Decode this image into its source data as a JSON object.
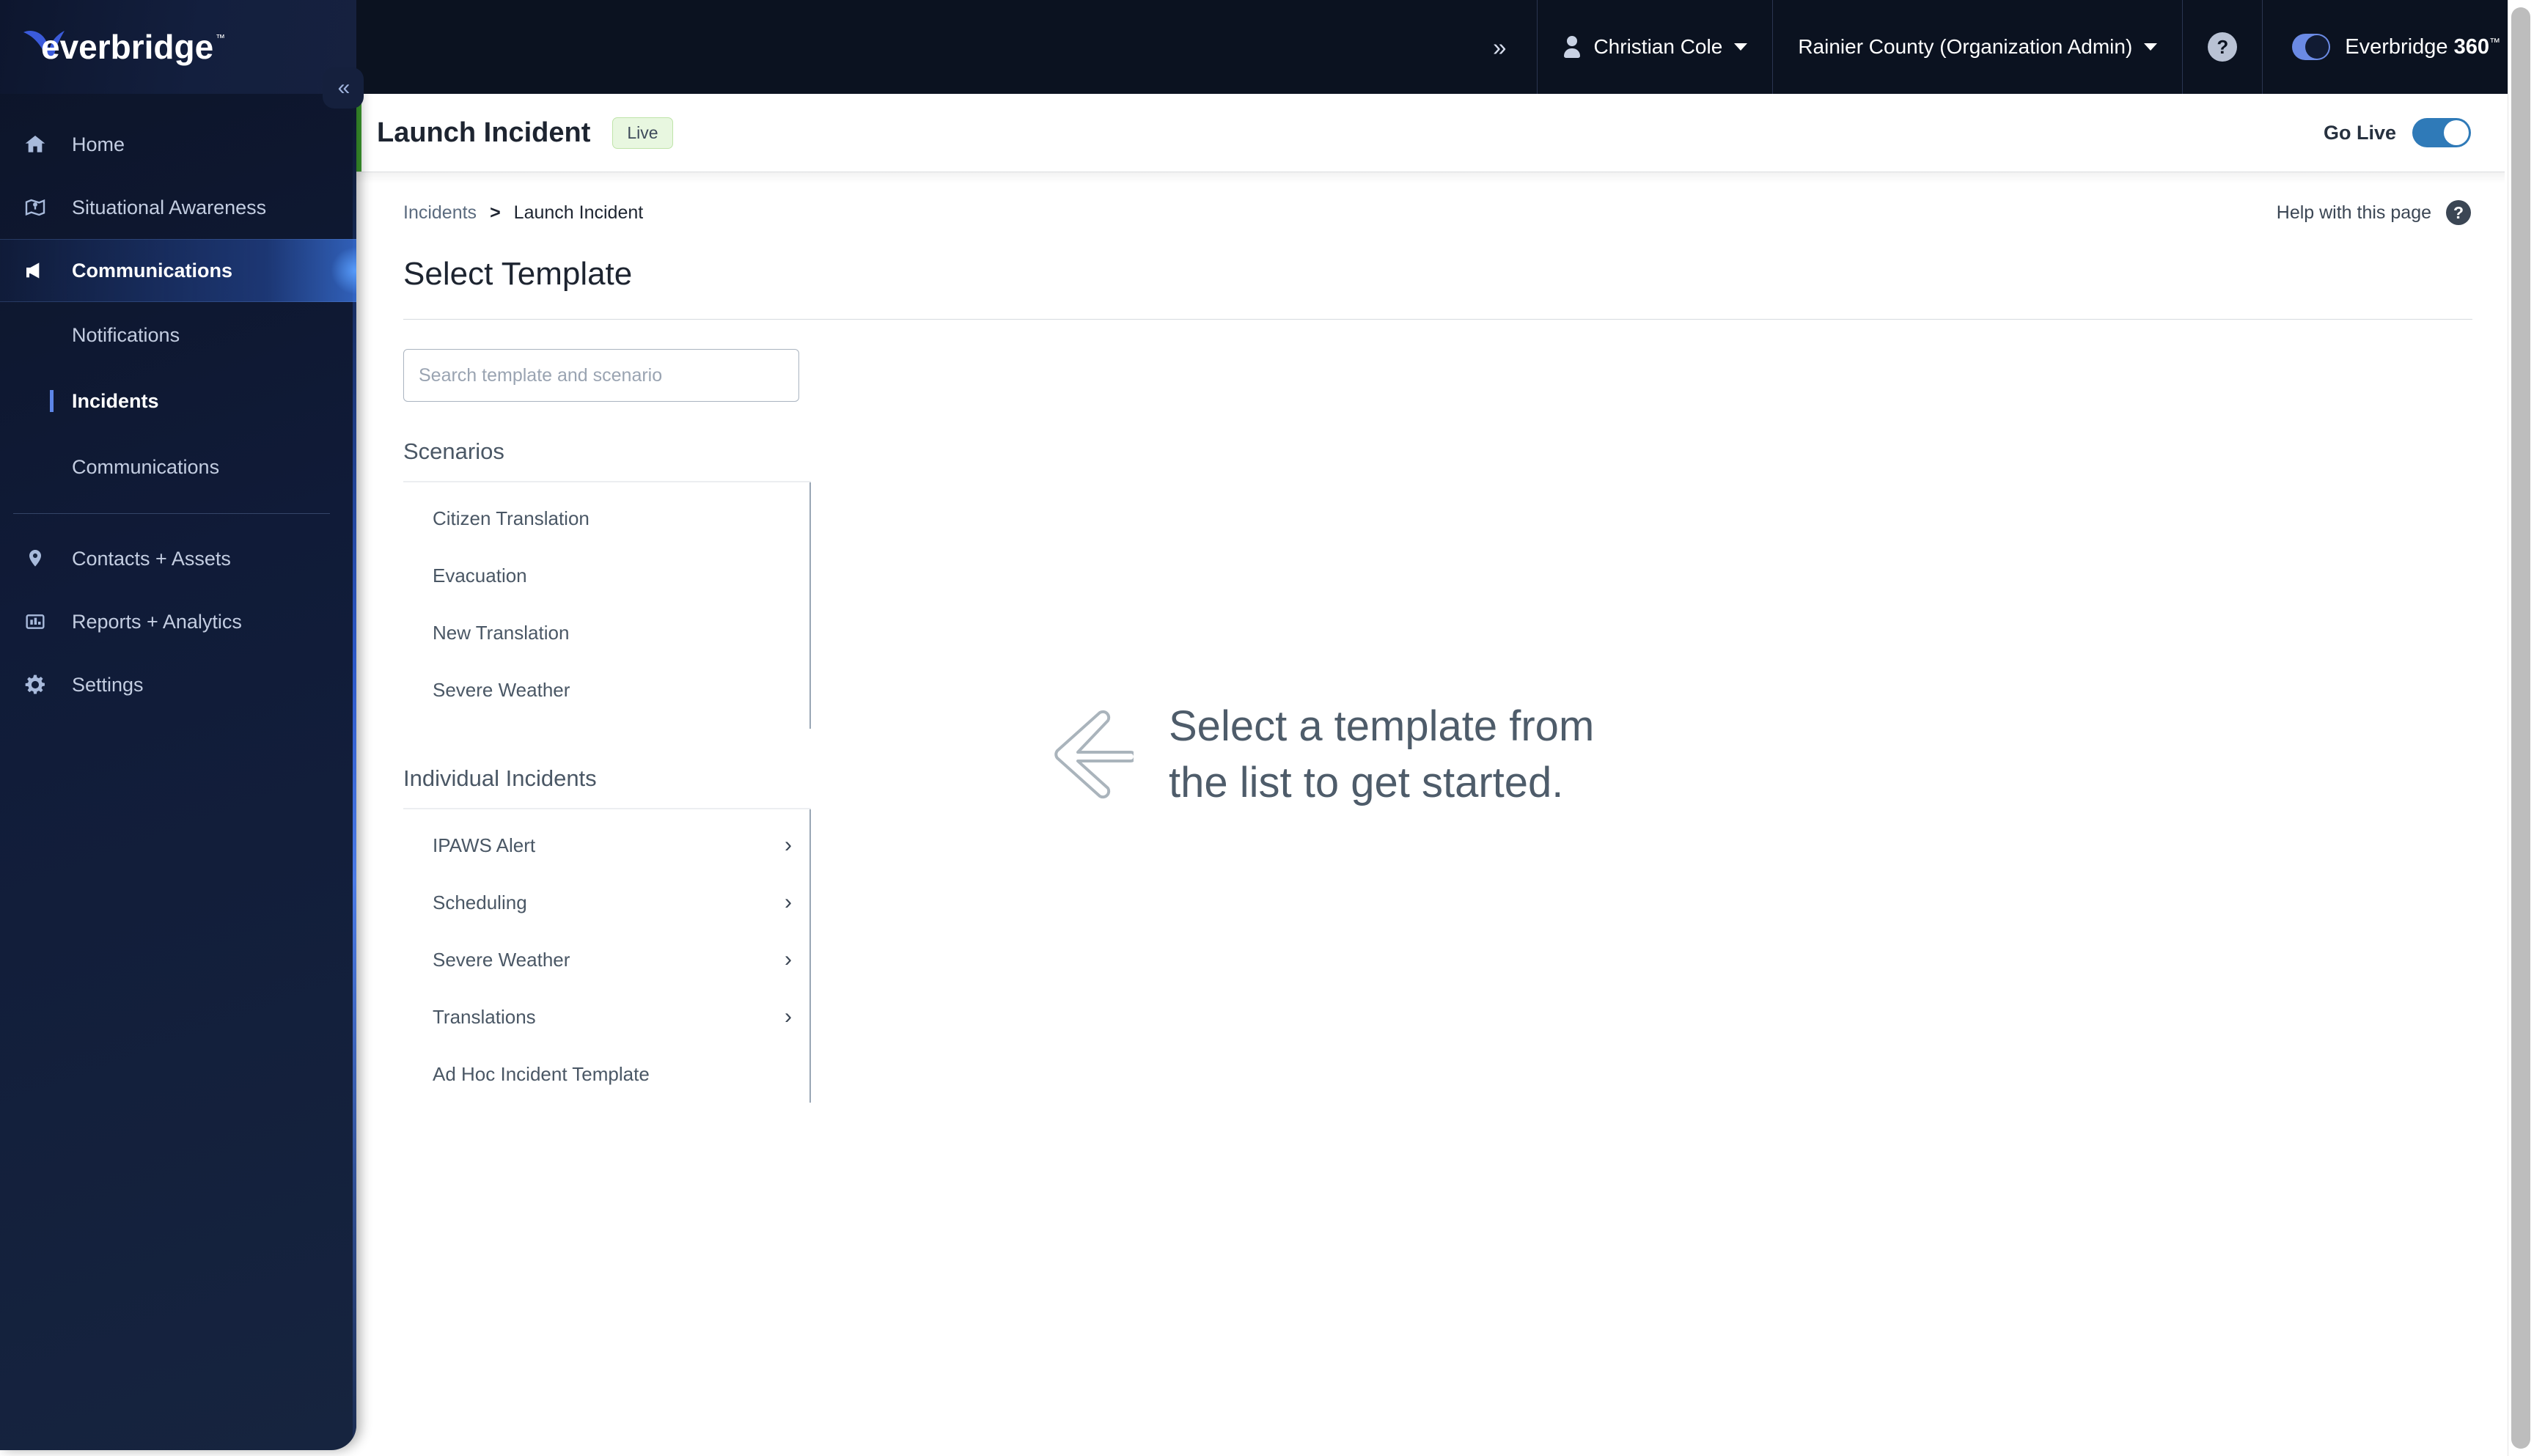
{
  "topbar": {
    "brand_logo_alt": "everbridge",
    "expand_icon": "»",
    "user_name": "Christian Cole",
    "org_name": "Rainier County (Organization Admin)",
    "help_icon_label": "?",
    "product_name_prefix": "Everbridge ",
    "product_name_suffix": "360",
    "product_tm": "™"
  },
  "sidebar": {
    "collapse_icon": "«",
    "items": [
      {
        "label": "Home",
        "icon": "home-icon"
      },
      {
        "label": "Situational Awareness",
        "icon": "map-icon"
      },
      {
        "label": "Communications",
        "icon": "megaphone-icon"
      }
    ],
    "sub_items": [
      {
        "label": "Notifications"
      },
      {
        "label": "Incidents"
      },
      {
        "label": "Communications"
      }
    ],
    "lower_items": [
      {
        "label": "Contacts + Assets",
        "icon": "location-pin-icon"
      },
      {
        "label": "Reports + Analytics",
        "icon": "bar-chart-icon"
      },
      {
        "label": "Settings",
        "icon": "gear-icon"
      }
    ]
  },
  "page_header": {
    "title": "Launch Incident",
    "badge": "Live",
    "go_live_label": "Go Live",
    "go_live_on": true
  },
  "breadcrumb": {
    "parent": "Incidents",
    "separator": ">",
    "current": "Launch Incident"
  },
  "help": {
    "label": "Help with this page",
    "icon": "?"
  },
  "main": {
    "heading": "Select Template",
    "search_placeholder": "Search template and scenario",
    "search_value": "",
    "scenarios": {
      "title": "Scenarios",
      "items": [
        {
          "label": "Citizen Translation",
          "has_chevron": false
        },
        {
          "label": "Evacuation",
          "has_chevron": false
        },
        {
          "label": "New Translation",
          "has_chevron": false
        },
        {
          "label": "Severe Weather",
          "has_chevron": false
        }
      ]
    },
    "individual_incidents": {
      "title": "Individual Incidents",
      "items": [
        {
          "label": "IPAWS Alert",
          "has_chevron": true
        },
        {
          "label": "Scheduling",
          "has_chevron": true
        },
        {
          "label": "Severe Weather",
          "has_chevron": true
        },
        {
          "label": "Translations",
          "has_chevron": true
        },
        {
          "label": "Ad Hoc Incident Template",
          "has_chevron": false
        }
      ]
    },
    "empty_state": {
      "line1": "Select a template from",
      "line2": "the list to get started.",
      "text": "Select a template from\nthe list to get started."
    }
  },
  "colors": {
    "sidebar_bg": "#0c1428",
    "topbar_bg": "#0b1220",
    "accent_blue": "#5d86e8",
    "green_stripe": "#3d9b2f",
    "badge_bg": "#e8f7e0",
    "badge_border": "#bfe4a9",
    "toggle_on": "#2f7ab8",
    "text_dark": "#1d2430",
    "text_muted": "#4a5765"
  },
  "chevron_glyph": "›"
}
